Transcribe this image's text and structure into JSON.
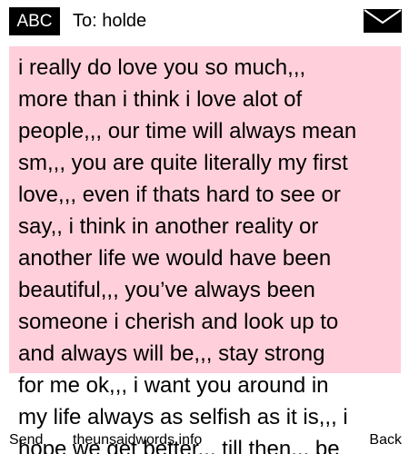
{
  "header": {
    "mode_badge": "ABC",
    "recipient": "To: holde",
    "message_icon": "envelope-icon"
  },
  "message": {
    "body": "i really do love you so much,,,\nmore than i think i love alot of\npeople,,, our time will always mean\nsm,,, you are quite literally my first\nlove,,, even if thats hard to see or\nsay,, i think in another reality or\nanother life we would have been\nbeautiful,,, you’ve always been\nsomeone i cherish and look up to\nand always will be,,, stay strong\nfor me ok,,, i want you around in\nmy life always as selfish as it is,,, i\nhope we get better,,, till then,,, be",
    "background": "#ffd0dc"
  },
  "softkeys": {
    "left": "Send",
    "center": "theunsaidwords.info",
    "right": "Back"
  }
}
